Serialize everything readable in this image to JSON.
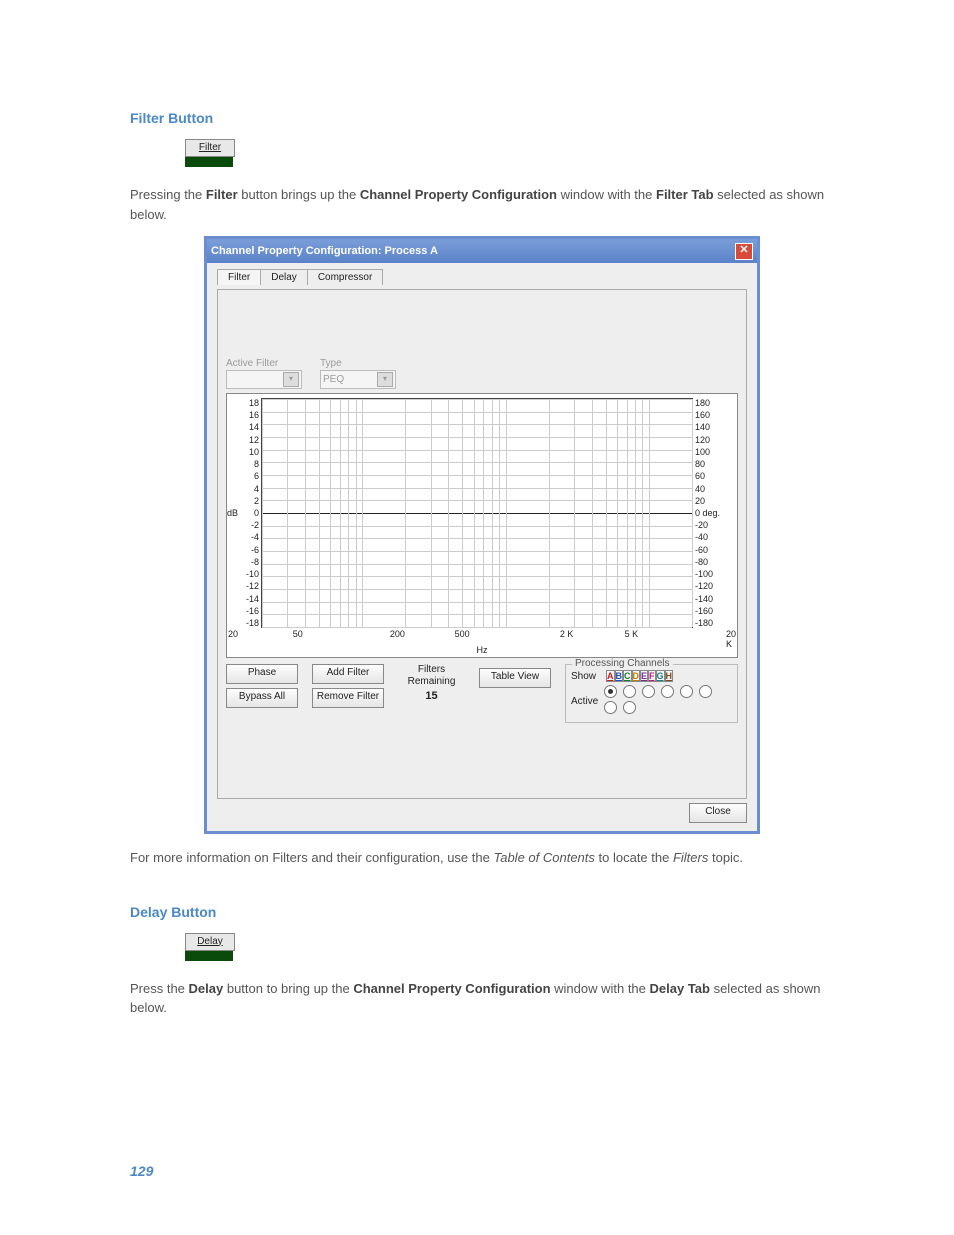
{
  "page_number": "129",
  "section1": {
    "heading": "Filter Button",
    "button_label": "Filter",
    "para_pre": "Pressing the ",
    "para_b1": "Filter",
    "para_mid1": " button brings up the ",
    "para_b2": "Channel Property Configuration",
    "para_mid2": " window with the ",
    "para_b3": "Filter Tab",
    "para_post": " selected as shown below.",
    "footer_pre": "For more information on Filters and their configuration, use the ",
    "footer_i1": "Table of Contents",
    "footer_mid": " to locate the ",
    "footer_i2": "Filters",
    "footer_post": " topic."
  },
  "window": {
    "title": "Channel Property Configuration: Process A",
    "tabs": [
      "Filter",
      "Delay",
      "Compressor"
    ],
    "active_filter_label": "Active Filter",
    "type_label": "Type",
    "type_value": "PEQ",
    "left_axis_label": "dB",
    "left_ticks": [
      "18",
      "16",
      "14",
      "12",
      "10",
      "8",
      "6",
      "4",
      "2",
      "0",
      "-2",
      "-4",
      "-6",
      "-8",
      "-10",
      "-12",
      "-14",
      "-16",
      "-18"
    ],
    "right_ticks": [
      "180",
      "160",
      "140",
      "120",
      "100",
      "80",
      "60",
      "40",
      "20",
      "0 deg.",
      "-20",
      "-40",
      "-60",
      "-80",
      "-100",
      "-120",
      "-140",
      "-160",
      "-180"
    ],
    "x_ticks": [
      {
        "label": "20",
        "pos": 0
      },
      {
        "label": "50",
        "pos": 13
      },
      {
        "label": "200",
        "pos": 33
      },
      {
        "label": "500",
        "pos": 46
      },
      {
        "label": "2 K",
        "pos": 67
      },
      {
        "label": "5 K",
        "pos": 80
      },
      {
        "label": "20 K",
        "pos": 100
      }
    ],
    "x_unit": "Hz",
    "buttons": {
      "phase": "Phase",
      "bypass_all": "Bypass All",
      "add_filter": "Add Filter",
      "remove_filter": "Remove Filter",
      "table_view": "Table View",
      "close": "Close"
    },
    "filters_remaining_label": "Filters Remaining",
    "filters_remaining_value": "15",
    "proc_channels": {
      "legend": "Processing Channels",
      "show": "Show",
      "active": "Active",
      "channels": [
        "A",
        "B",
        "C",
        "D",
        "E",
        "F",
        "G",
        "H"
      ],
      "active_index": 0
    }
  },
  "section2": {
    "heading": "Delay Button",
    "button_label": "Delay",
    "para_pre": "Press the ",
    "para_b1": "Delay",
    "para_mid1": " button to bring up the ",
    "para_b2": "Channel Property Configuration",
    "para_mid2": " window with the ",
    "para_b3": "Delay Tab",
    "para_post": " selected as shown below."
  }
}
